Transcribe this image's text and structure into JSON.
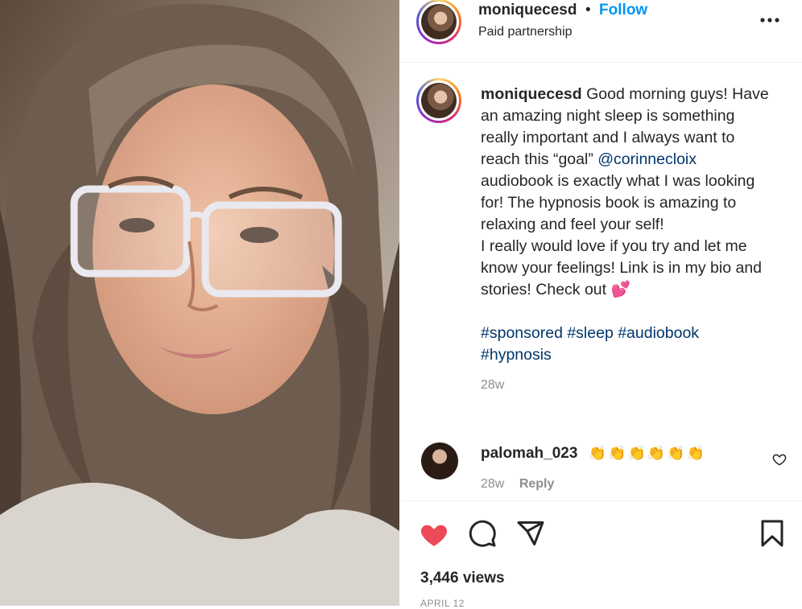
{
  "post": {
    "username": "moniquecesd",
    "follow_label": "Follow",
    "dot": "•",
    "subtitle": "Paid partnership",
    "more_label": "•••"
  },
  "caption": {
    "username": "moniquecesd",
    "text_1": "Good morning guys! Have an amazing night sleep is something really important and I always want to reach this “goal”",
    "mention": "@corinnecloix",
    "text_2": "audiobook is exactly what I was looking for! The hypnosis book is amazing to relaxing and feel your self!",
    "text_3": "I really would love if you try and let me know your feelings! Link is in my bio and stories! Check out 💕",
    "hashtags": "#sponsored #sleep #audiobook #hypnosis",
    "time": "28w"
  },
  "comment": {
    "username": "palomah_023",
    "text": "👏👏👏👏👏👏",
    "time": "28w",
    "reply_label": "Reply"
  },
  "stats": {
    "views": "3,446 views",
    "date": "APRIL 12"
  },
  "colors": {
    "like": "#ed4956",
    "link": "#00376b",
    "follow": "#0095f6"
  },
  "icons": [
    "heart-icon",
    "comment-icon",
    "share-icon",
    "bookmark-icon",
    "more-icon",
    "small-heart-icon"
  ]
}
